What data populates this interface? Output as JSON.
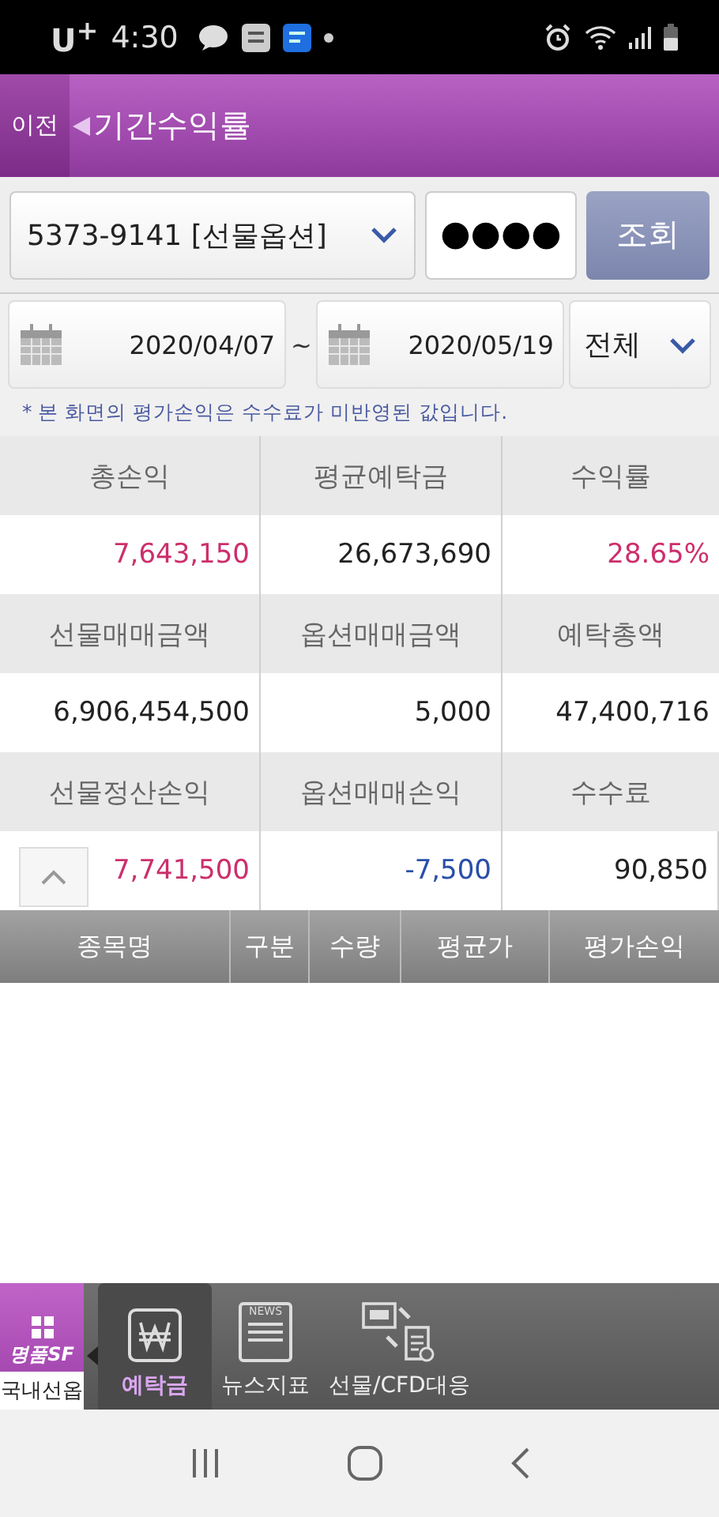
{
  "status_bar": {
    "carrier": "U$^{+}$",
    "time": "4:30"
  },
  "header": {
    "back": "이전",
    "title": "기간수익률"
  },
  "account": {
    "value": "5373-9141 [선물옵션]",
    "password": "●●●●",
    "button": "조회"
  },
  "period": {
    "start": "2020/04/07",
    "separator": "~",
    "end": "2020/05/19",
    "filter": "전체"
  },
  "note": "* 본 화면의 평가손익은 수수료가 미반영된 값입니다.",
  "summary": [
    [
      {
        "label": "총손익",
        "value": "7,643,150",
        "color": "#cc2f6c"
      },
      {
        "label": "평균예탁금",
        "value": "26,673,690",
        "color": "#222222"
      },
      {
        "label": "수익률",
        "value": "28.65%",
        "color": "#cc2f6c"
      }
    ],
    [
      {
        "label": "선물매매금액",
        "value": "6,906,454,500",
        "color": "#222222"
      },
      {
        "label": "옵션매매금액",
        "value": "5,000",
        "color": "#222222"
      },
      {
        "label": "예탁총액",
        "value": "47,400,716",
        "color": "#222222"
      }
    ],
    [
      {
        "label": "선물정산손익",
        "value": "7,741,500",
        "color": "#cc2f6c"
      },
      {
        "label": "옵션매매손익",
        "value": "-7,500",
        "color": "#2a4fa8"
      },
      {
        "label": "수수료",
        "value": "90,850",
        "color": "#222222"
      }
    ]
  ],
  "table": {
    "columns": [
      "종목명",
      "구분",
      "수량",
      "평균가",
      "평가손익"
    ]
  },
  "toolbar": {
    "side_tab": {
      "logo": "명품SF",
      "label": "국내선옵"
    },
    "items": [
      {
        "kind": "won",
        "label": "예탁금",
        "selected": true
      },
      {
        "kind": "news",
        "badge": "NEWS",
        "label": "뉴스지표",
        "selected": false
      },
      {
        "kind": "transfer",
        "label": "선물/CFD대응",
        "selected": false
      }
    ]
  }
}
